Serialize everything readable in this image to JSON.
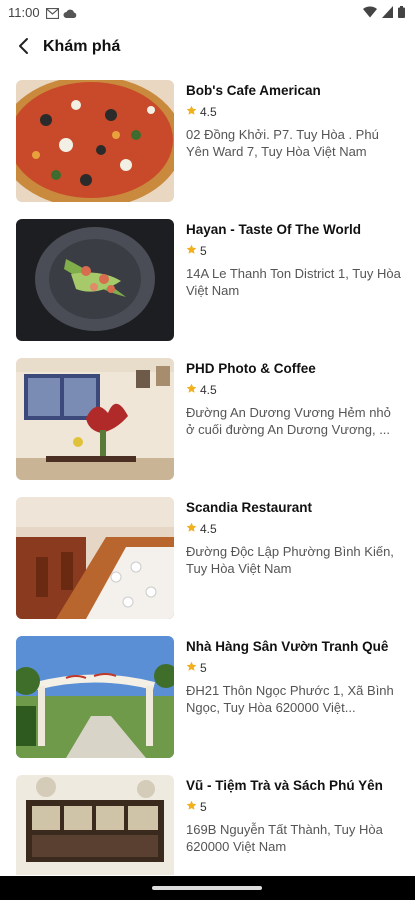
{
  "status_bar": {
    "time": "11:00",
    "icons": [
      "gmail-icon",
      "cloud-icon",
      "wifi-icon",
      "signal-icon",
      "battery-icon"
    ]
  },
  "app_bar": {
    "back_icon": "arrow-back-icon",
    "title": "Khám phá"
  },
  "colors": {
    "star": "#F2B01E",
    "nav_bar": "#000000"
  },
  "places": [
    {
      "name": "Bob's Cafe American",
      "rating": "4.5",
      "address": "02 Đồng Khởi. P7. Tuy Hòa . Phú Yên Ward 7, Tuy Hòa Việt Nam",
      "image": "pizza-photo"
    },
    {
      "name": "Hayan - Taste Of The World",
      "rating": "5",
      "address": "14A Le Thanh Ton District 1, Tuy Hòa Việt Nam",
      "image": "plated-dish-photo"
    },
    {
      "name": "PHD Photo & Coffee",
      "rating": "4.5",
      "address": "Đường An Dương Vương Hẻm nhỏ ở cuối đường An Dương Vương, ...",
      "image": "cafe-interior-photo"
    },
    {
      "name": "Scandia Restaurant",
      "rating": "4.5",
      "address": "Đường Độc Lập Phường Bình Kiến, Tuy Hòa Việt Nam",
      "image": "restaurant-tables-photo"
    },
    {
      "name": "Nhà Hàng Sân Vườn Tranh Quê",
      "rating": "5",
      "address": "ĐH21 Thôn Ngọc Phước 1, Xã Bình Ngọc, Tuy Hòa 620000 Việt...",
      "image": "garden-restaurant-gate-photo"
    },
    {
      "name": "Vũ - Tiệm Trà và Sách Phú Yên",
      "rating": "5",
      "address": "169B Nguyễn Tất Thành, Tuy Hòa 620000 Việt Nam",
      "image": "tea-book-shop-photo"
    }
  ]
}
